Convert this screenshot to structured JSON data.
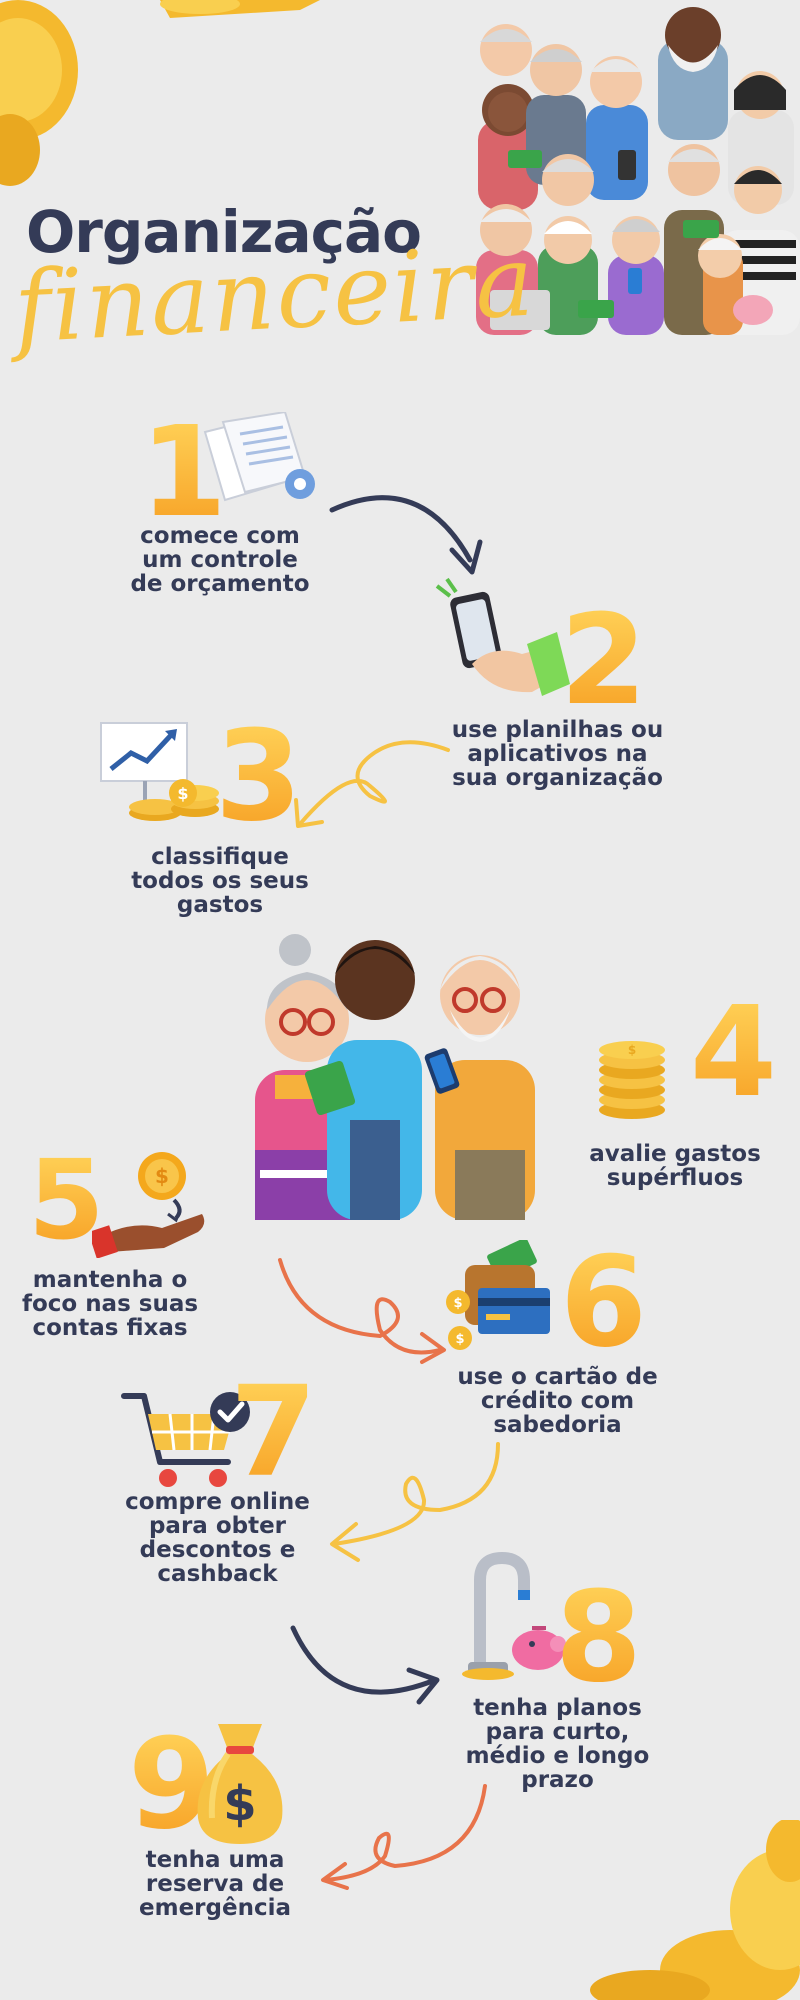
{
  "title": {
    "line1": "Organização",
    "line2": "financeira"
  },
  "steps": [
    {
      "number": "1",
      "text": "comece com\num controle\nde orçamento"
    },
    {
      "number": "2",
      "text": "use planilhas ou\naplicativos na\nsua organização"
    },
    {
      "number": "3",
      "text": "classifique\ntodos os seus\ngastos"
    },
    {
      "number": "4",
      "text": "avalie gastos\nsupérfluos"
    },
    {
      "number": "5",
      "text": "mantenha o\nfoco nas suas\ncontas fixas"
    },
    {
      "number": "6",
      "text": "use o cartão de\ncrédito com\nsabedoria"
    },
    {
      "number": "7",
      "text": "compre online\npara obter\ndescontos e\ncashback"
    },
    {
      "number": "8",
      "text": "tenha planos\npara  curto,\nmédio e longo\nprazo"
    },
    {
      "number": "9",
      "text": "tenha uma\nreserva de\nemergência"
    }
  ],
  "colors": {
    "background": "#ebebeb",
    "navy": "#343b57",
    "gold": "#f6c243",
    "orange": "#f7a024",
    "coral": "#e8734a",
    "money_green": "#3aa44a"
  }
}
